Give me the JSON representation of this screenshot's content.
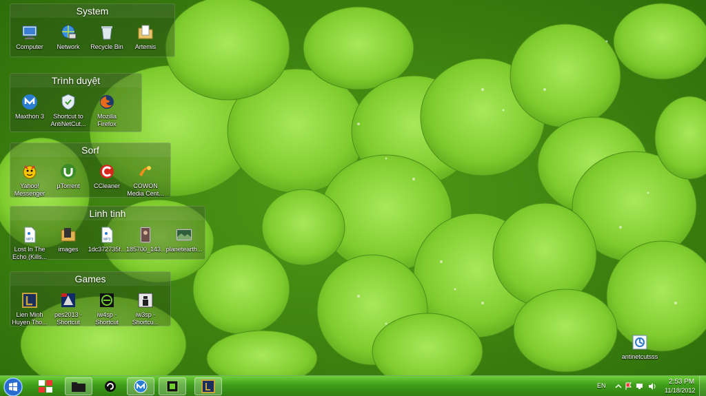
{
  "desktop": {
    "fences": [
      {
        "title": "System",
        "icons": [
          {
            "label": "Computer",
            "icon": "computer-icon"
          },
          {
            "label": "Network",
            "icon": "network-icon"
          },
          {
            "label": "Recycle Bin",
            "icon": "recycle-bin-icon"
          },
          {
            "label": "Artemis",
            "icon": "folder-icon"
          }
        ]
      },
      {
        "title": "Trình duyệt",
        "icons": [
          {
            "label": "Maxthon 3",
            "icon": "maxthon-icon"
          },
          {
            "label": "Shortcut to AntiNetCut...",
            "icon": "shield-icon"
          },
          {
            "label": "Mozilla Firefox",
            "icon": "firefox-icon"
          }
        ]
      },
      {
        "title": "Sorf",
        "icons": [
          {
            "label": "Yahoo! Messenger",
            "icon": "yahoo-messenger-icon"
          },
          {
            "label": "µTorrent",
            "icon": "utorrent-icon"
          },
          {
            "label": "CCleaner",
            "icon": "ccleaner-icon"
          },
          {
            "label": "COWON Media Cent...",
            "icon": "cowon-icon"
          }
        ]
      },
      {
        "title": "Linh tinh",
        "icons": [
          {
            "label": "Lost In The Echo (Kills...",
            "icon": "mp3-file-icon"
          },
          {
            "label": "images",
            "icon": "folder-icon"
          },
          {
            "label": "1dc372735f...",
            "icon": "mp3-file-icon"
          },
          {
            "label": "185700_143...",
            "icon": "image-file-icon"
          },
          {
            "label": "planetearth...",
            "icon": "image-file-icon"
          }
        ]
      },
      {
        "title": "Games",
        "icons": [
          {
            "label": "Lien Minh Huyen Tho...",
            "icon": "lol-icon"
          },
          {
            "label": "pes2013 - Shortcut",
            "icon": "pes-icon"
          },
          {
            "label": "iw4sp - Shortcut",
            "icon": "iw4sp-icon"
          },
          {
            "label": "iw3sp - Shortcu...",
            "icon": "iw3sp-icon"
          }
        ]
      }
    ],
    "loose_icon": {
      "label": "antinetcutsss",
      "icon": "antinetcut-icon"
    }
  },
  "taskbar": {
    "buttons": [
      {
        "name": "start-orb",
        "icon": "windows-logo-icon"
      },
      {
        "name": "taskbar-app-1",
        "icon": "grid-app-icon"
      },
      {
        "name": "taskbar-explorer",
        "icon": "folder-icon"
      },
      {
        "name": "taskbar-app-3",
        "icon": "swirl-icon"
      },
      {
        "name": "taskbar-maxthon",
        "icon": "maxthon-icon"
      },
      {
        "name": "taskbar-app-5",
        "icon": "game-icon"
      },
      {
        "name": "taskbar-lol",
        "icon": "lol-icon"
      }
    ],
    "tray": {
      "language": "EN",
      "time": "2:53 PM",
      "date": "11/18/2012"
    }
  },
  "colors": {
    "taskbar_top": "#6ecf3a",
    "taskbar_bottom": "#2f7f10",
    "wallpaper_green": "#5aa51b"
  }
}
